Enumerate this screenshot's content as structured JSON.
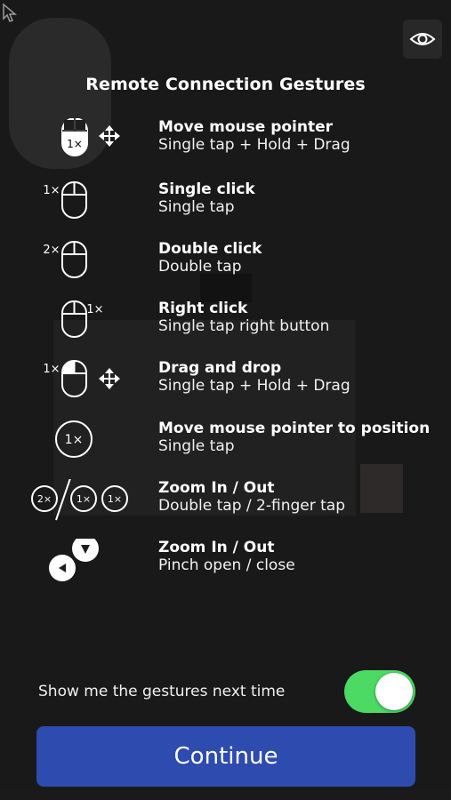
{
  "title": "Remote Connection Gestures",
  "gestures": [
    {
      "title": "Move mouse pointer",
      "desc": "Single tap + Hold + Drag",
      "icon": "mouse-left-press-move-icon",
      "badge": "1×"
    },
    {
      "title": "Single click",
      "desc": "Single tap",
      "icon": "mouse-left-click-icon",
      "badge": "1×"
    },
    {
      "title": "Double click",
      "desc": "Double tap",
      "icon": "mouse-double-click-icon",
      "badge": "2×"
    },
    {
      "title": "Right click",
      "desc": "Single tap right button",
      "icon": "mouse-right-click-icon",
      "badge": "1×"
    },
    {
      "title": "Drag and drop",
      "desc": "Single tap + Hold + Drag",
      "icon": "mouse-drag-icon",
      "badge": "1×"
    },
    {
      "title": "Move mouse pointer to position",
      "desc": "Single tap",
      "icon": "tap-position-icon",
      "badge": "1×"
    },
    {
      "title": "Zoom In / Out",
      "desc": "Double tap / 2-finger tap",
      "icon": "zoom-tap-icon",
      "badges": [
        "2×",
        "1×",
        "1×"
      ]
    },
    {
      "title": "Zoom In / Out",
      "desc": "Pinch open / close",
      "icon": "pinch-icon"
    }
  ],
  "footer": {
    "show_label": "Show me the gestures next time",
    "show_toggle_on": true,
    "continue_label": "Continue"
  },
  "colors": {
    "toggle_on": "#4cd964",
    "continue_button": "#2e4bb0",
    "background": "#1e1e1e"
  }
}
